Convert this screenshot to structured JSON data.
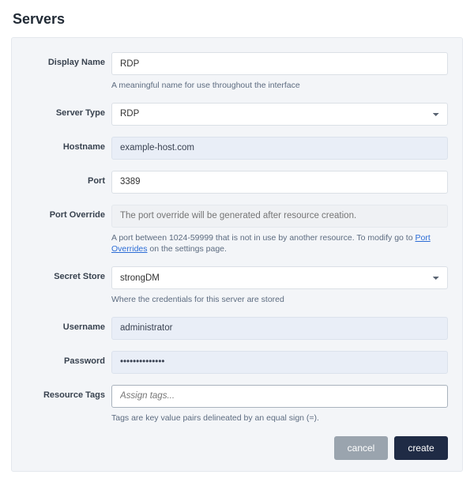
{
  "header": {
    "title": "Servers"
  },
  "form": {
    "display_name": {
      "label": "Display Name",
      "value": "RDP",
      "help": "A meaningful name for use throughout the interface"
    },
    "server_type": {
      "label": "Server Type",
      "value": "RDP"
    },
    "hostname": {
      "label": "Hostname",
      "value": "example-host.com"
    },
    "port": {
      "label": "Port",
      "value": "3389"
    },
    "port_override": {
      "label": "Port Override",
      "placeholder": "The port override will be generated after resource creation.",
      "help_prefix": "A port between 1024-59999 that is not in use by another resource. To modify go to ",
      "help_link": "Port Overrides",
      "help_suffix": " on the settings page."
    },
    "secret_store": {
      "label": "Secret Store",
      "value": "strongDM",
      "help": "Where the credentials for this server are stored"
    },
    "username": {
      "label": "Username",
      "value": "administrator"
    },
    "password": {
      "label": "Password",
      "value": "••••••••••••••"
    },
    "resource_tags": {
      "label": "Resource Tags",
      "placeholder": "Assign tags...",
      "help": "Tags are key value pairs delineated by an equal sign (=)."
    }
  },
  "actions": {
    "cancel": "cancel",
    "create": "create"
  }
}
